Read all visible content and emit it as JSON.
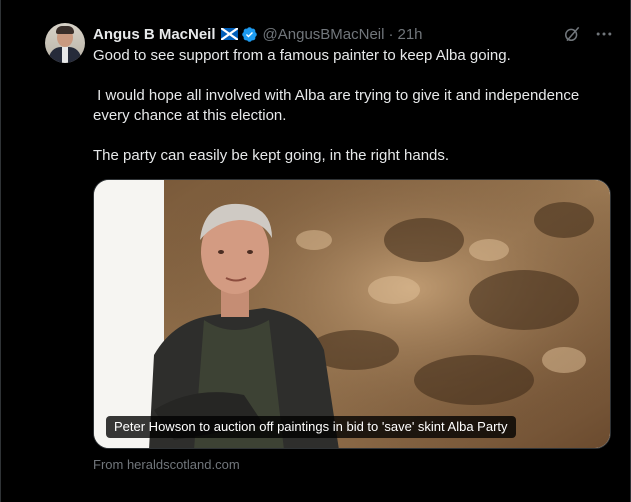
{
  "post": {
    "author_name": "Angus B MacNeil",
    "handle": "@AngusBMacNeil",
    "separator": "·",
    "time": "21h",
    "text_lines": [
      "Good to see support from a famous painter to keep Alba going.",
      " I would hope all involved with Alba are trying to give it and independence every chance at this election.",
      "The party can easily be kept going, in the right hands."
    ]
  },
  "link_card": {
    "caption": "Peter Howson to auction off paintings in bid to 'save' skint Alba Party",
    "source": "From heraldscotland.com"
  },
  "icons": {
    "flag": "scotland-flag-icon",
    "verified": "verified-badge-icon",
    "grok": "grok-icon",
    "more": "more-options-icon"
  },
  "colors": {
    "background": "#000000",
    "text_primary": "#e7e9ea",
    "text_secondary": "#71767b",
    "verified_blue": "#1d9bf0",
    "flag_blue": "#005eb8"
  }
}
